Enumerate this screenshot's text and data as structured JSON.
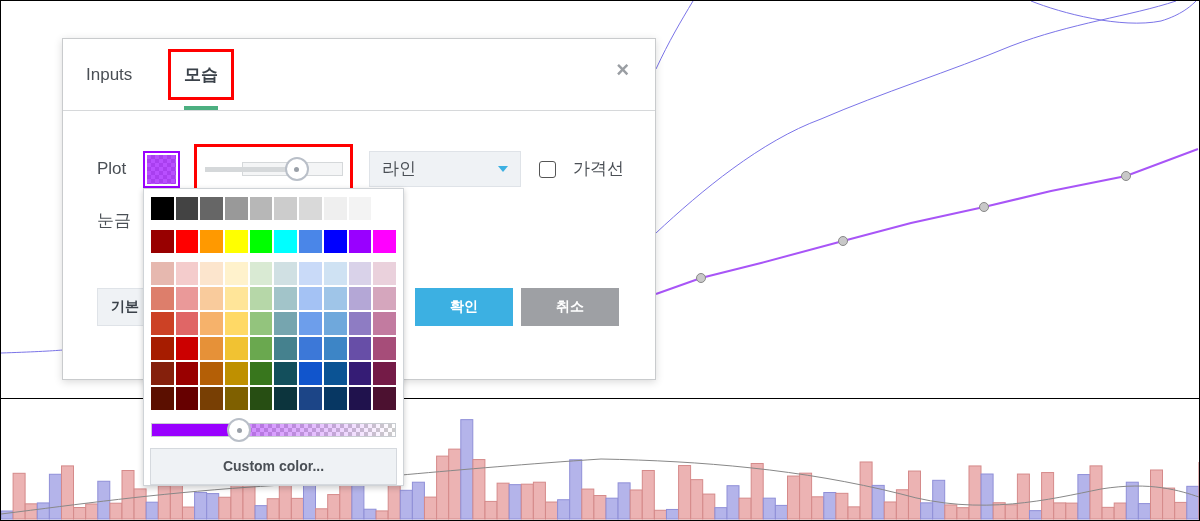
{
  "dialog": {
    "tabs": [
      {
        "label": "Inputs",
        "selected": false,
        "highlighted": false
      },
      {
        "label": "모습",
        "selected": true,
        "highlighted": true
      }
    ],
    "close": "×",
    "plot": {
      "label": "Plot",
      "color": "#9900ff",
      "width_slider": {
        "level": 0.67,
        "highlighted": true
      },
      "style": "라인",
      "price_line": {
        "label": "가격선",
        "checked": false
      }
    },
    "ticks_label": "눈금",
    "buttons": [
      {
        "label": "기본",
        "kind": "default"
      },
      {
        "label": "확인",
        "kind": "primary"
      },
      {
        "label": "취소",
        "kind": "secondary"
      }
    ]
  },
  "color_picker": {
    "swatch_rows": [
      [
        {
          "color": "#000000"
        },
        {
          "color": "#434343"
        },
        {
          "color": "#666666"
        },
        {
          "color": "#999999"
        },
        {
          "color": "#b7b7b7"
        },
        {
          "color": "#cccccc"
        },
        {
          "color": "#d9d9d9"
        },
        {
          "color": "#efefef"
        },
        {
          "color": "#f3f3f3"
        }
      ],
      [
        {
          "color": "#980000"
        },
        {
          "color": "#ff0000"
        },
        {
          "color": "#ff9900"
        },
        {
          "color": "#ffff00"
        },
        {
          "color": "#00ff00"
        },
        {
          "color": "#00ffff"
        },
        {
          "color": "#4a86e8"
        },
        {
          "color": "#0000ff"
        },
        {
          "color": "#9900ff"
        },
        {
          "color": "#ff00ff"
        }
      ],
      [
        {
          "color": "#e6b8af"
        },
        {
          "color": "#f4cccc"
        },
        {
          "color": "#fce5cd"
        },
        {
          "color": "#fff2cc"
        },
        {
          "color": "#d9ead3"
        },
        {
          "color": "#d0e0e3"
        },
        {
          "color": "#c9daf8"
        },
        {
          "color": "#cfe2f3"
        },
        {
          "color": "#d9d2e9"
        },
        {
          "color": "#ead1dc"
        }
      ],
      [
        {
          "color": "#dd7e6b"
        },
        {
          "color": "#ea9999"
        },
        {
          "color": "#f9cb9c"
        },
        {
          "color": "#ffe599"
        },
        {
          "color": "#b6d7a8"
        },
        {
          "color": "#a2c4c9"
        },
        {
          "color": "#a4c2f4"
        },
        {
          "color": "#9fc5e8"
        },
        {
          "color": "#b4a7d6"
        },
        {
          "color": "#d5a6bd"
        }
      ],
      [
        {
          "color": "#cc4125"
        },
        {
          "color": "#e06666"
        },
        {
          "color": "#f6b26b"
        },
        {
          "color": "#ffd966"
        },
        {
          "color": "#93c47d"
        },
        {
          "color": "#76a5af"
        },
        {
          "color": "#6d9eeb"
        },
        {
          "color": "#6fa8dc"
        },
        {
          "color": "#8e7cc3"
        },
        {
          "color": "#c27ba0"
        }
      ],
      [
        {
          "color": "#a61c00"
        },
        {
          "color": "#cc0000"
        },
        {
          "color": "#e69138"
        },
        {
          "color": "#f1c232"
        },
        {
          "color": "#6aa84f"
        },
        {
          "color": "#45818e"
        },
        {
          "color": "#3c78d8"
        },
        {
          "color": "#3d85c6"
        },
        {
          "color": "#674ea7"
        },
        {
          "color": "#a64d79"
        }
      ],
      [
        {
          "color": "#85200c"
        },
        {
          "color": "#990000"
        },
        {
          "color": "#b45f06"
        },
        {
          "color": "#bf9000"
        },
        {
          "color": "#38761d"
        },
        {
          "color": "#134f5c"
        },
        {
          "color": "#1155cc"
        },
        {
          "color": "#0b5394"
        },
        {
          "color": "#351c75"
        },
        {
          "color": "#741b47"
        }
      ],
      [
        {
          "color": "#5b0f00"
        },
        {
          "color": "#660000"
        },
        {
          "color": "#783f04"
        },
        {
          "color": "#7f6000"
        },
        {
          "color": "#274e13"
        },
        {
          "color": "#0c343d"
        },
        {
          "color": "#1c4587"
        },
        {
          "color": "#073763"
        },
        {
          "color": "#20124d"
        },
        {
          "color": "#4c1130"
        }
      ]
    ],
    "opacity": {
      "level": 0.36
    },
    "custom_button": "Custom color..."
  }
}
